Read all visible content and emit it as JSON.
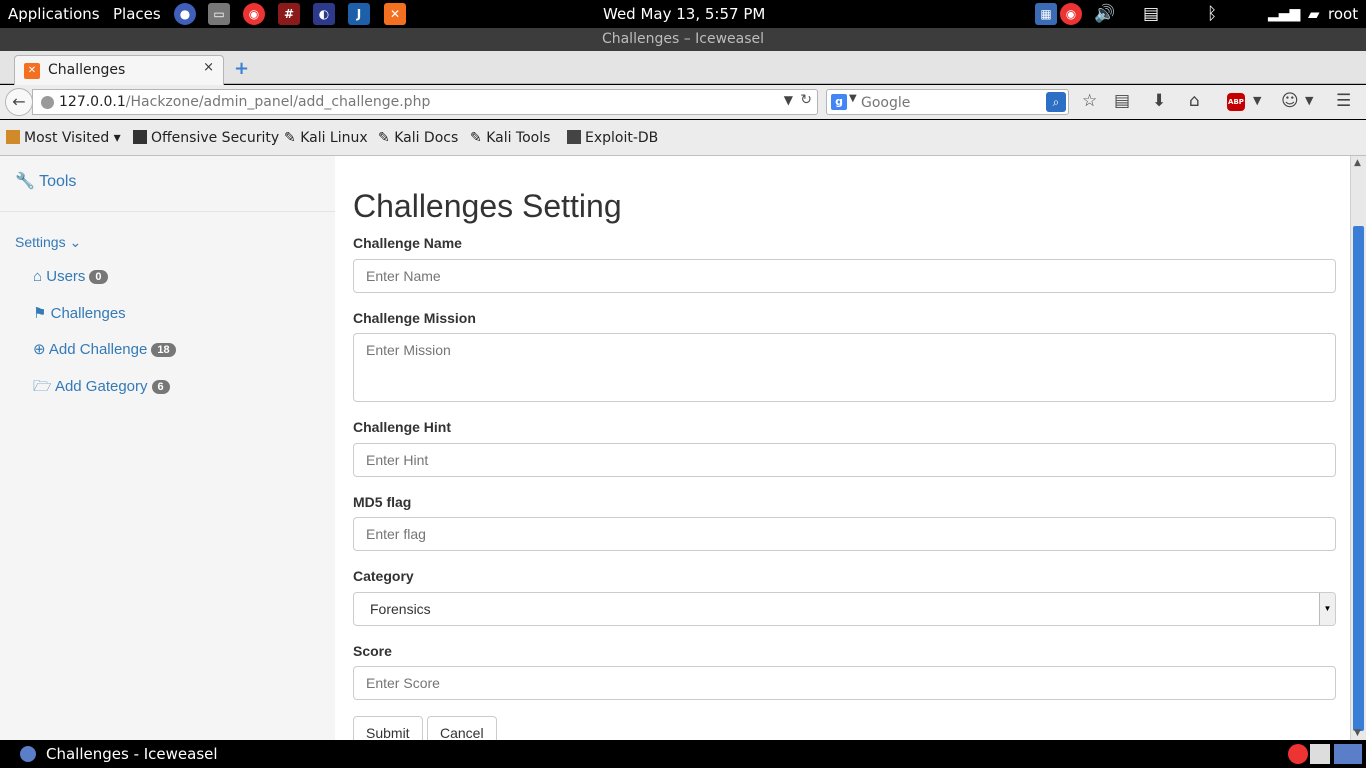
{
  "top_panel": {
    "applications": "Applications",
    "places": "Places",
    "clock": "Wed May 13,  5:57 PM",
    "user": "root"
  },
  "window": {
    "title": "Challenges – Iceweasel"
  },
  "tab": {
    "title": "Challenges",
    "close": "×",
    "new": "+"
  },
  "navbar": {
    "url_host": "127.0.0.1",
    "url_path": "/Hackzone/admin_panel/add_challenge.php",
    "search_placeholder": "Google"
  },
  "bookmarks": [
    "Most Visited",
    "Offensive Security",
    "Kali Linux",
    "Kali Docs",
    "Kali Tools",
    "Exploit-DB"
  ],
  "sidebar": {
    "tools": "Tools",
    "settings": "Settings",
    "items": [
      {
        "label": "Users",
        "badge": "0"
      },
      {
        "label": "Challenges",
        "badge": ""
      },
      {
        "label": "Add Challenge",
        "badge": "18"
      },
      {
        "label": "Add Gategory",
        "badge": "6"
      }
    ]
  },
  "form": {
    "title": "Challenges Setting",
    "name_label": "Challenge Name",
    "name_placeholder": "Enter Name",
    "mission_label": "Challenge Mission",
    "mission_placeholder": "Enter Mission",
    "hint_label": "Challenge Hint",
    "hint_placeholder": "Enter Hint",
    "flag_label": "MD5 flag",
    "flag_placeholder": "Enter flag",
    "category_label": "Category",
    "category_value": "Forensics",
    "score_label": "Score",
    "score_placeholder": "Enter Score",
    "submit": "Submit",
    "cancel": "Cancel"
  },
  "taskbar": {
    "window": "Challenges - Iceweasel"
  },
  "colors": {
    "link": "#337ab7",
    "badge": "#777777",
    "scroll_thumb": "#3a7dd6"
  }
}
